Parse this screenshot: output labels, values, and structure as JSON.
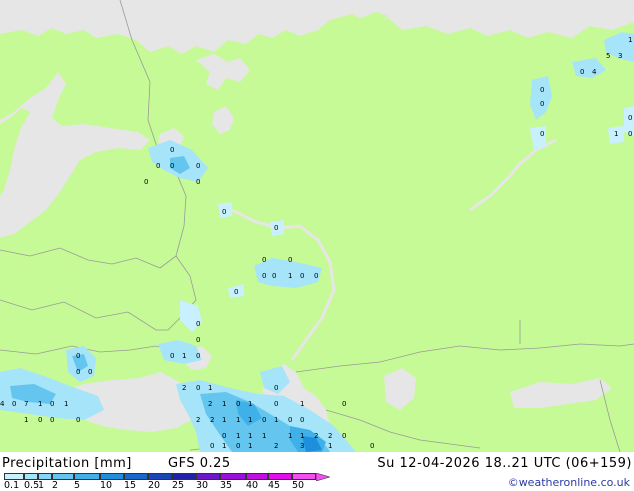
{
  "footer": {
    "title": "Precipitation [mm]",
    "model": "GFS 0.25",
    "datetime": "Su 12-04-2026 18..21 UTC (06+159)",
    "credit": "©weatheronline.co.uk"
  },
  "legend": {
    "ticks": [
      "0.1",
      "0.5",
      "1",
      "2",
      "5",
      "10",
      "15",
      "20",
      "25",
      "30",
      "35",
      "40",
      "45",
      "50"
    ],
    "colors": [
      "#c8f0ff",
      "#a6e4fa",
      "#86d6f5",
      "#64c6ef",
      "#3fb1e8",
      "#1e8fdc",
      "#1868cc",
      "#1a45b8",
      "#2222a8",
      "#6a18c8",
      "#9a10d8",
      "#c010e0",
      "#e010e8",
      "#f050f0"
    ]
  },
  "map": {
    "colors": {
      "land": "#c6fa96",
      "sea": "#e6e6e6",
      "border": "#9a9a9a"
    },
    "labels": [
      "0",
      "0",
      "0",
      "0",
      "0",
      "0",
      "0",
      "0",
      "0",
      "0",
      "0",
      "0",
      "1",
      "0",
      "0",
      "0",
      "0",
      "0",
      "0",
      "1",
      "0",
      "0",
      "0",
      "0",
      "0",
      "2",
      "1",
      "0",
      "0",
      "4",
      "0",
      "7",
      "1",
      "0",
      "1",
      "2",
      "1",
      "0",
      "1",
      "0",
      "1",
      "1",
      "0",
      "0",
      "0",
      "2",
      "2",
      "1",
      "1",
      "1",
      "0",
      "1",
      "0",
      "0",
      "0",
      "1",
      "1",
      "1",
      "1",
      "1",
      "2",
      "2",
      "0",
      "0",
      "0",
      "0",
      "0",
      "4",
      "5",
      "3",
      "1",
      "0",
      "1",
      "0",
      "0",
      "1",
      "0",
      "1",
      "2",
      "3",
      "1",
      "0"
    ]
  }
}
